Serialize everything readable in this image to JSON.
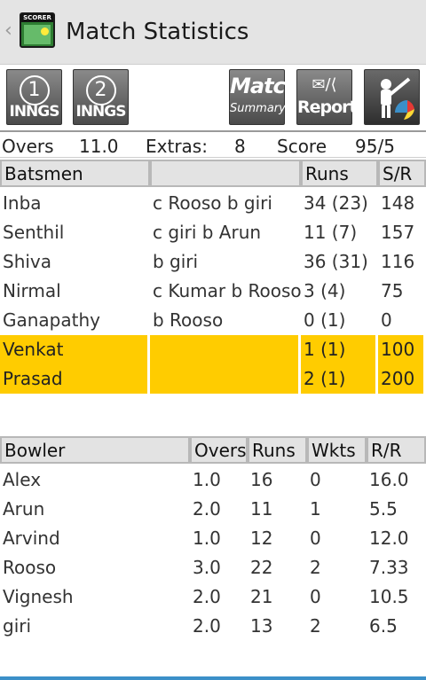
{
  "actionbar": {
    "title": "Match Statistics",
    "back_icon": "chevron-left-icon",
    "app_icon_text": "SCORER"
  },
  "toolbar": {
    "innings1": {
      "num": "1",
      "label": "INNGS"
    },
    "innings2": {
      "num": "2",
      "label": "INNGS"
    },
    "summary": {
      "big": "Match",
      "small": "Summary"
    },
    "reports": {
      "icons": "✉/⟨",
      "label": "Reports"
    }
  },
  "summary_line": {
    "overs_label": "Overs",
    "overs": "11.0",
    "extras_label": "Extras:",
    "extras": "8",
    "score_label": "Score",
    "score": "95/5"
  },
  "batting": {
    "headers": [
      "Batsmen",
      "",
      "Runs",
      "S/R"
    ],
    "rows": [
      {
        "name": "Inba",
        "dismissal": "c Rooso b giri",
        "runs": "34 (23)",
        "sr": "148",
        "highlight": false
      },
      {
        "name": "Senthil",
        "dismissal": "c giri b Arun",
        "runs": "11 (7)",
        "sr": "157",
        "highlight": false
      },
      {
        "name": "Shiva",
        "dismissal": "b giri",
        "runs": "36 (31)",
        "sr": "116",
        "highlight": false
      },
      {
        "name": "Nirmal",
        "dismissal": "c Kumar b Rooso",
        "runs": "3 (4)",
        "sr": "75",
        "highlight": false
      },
      {
        "name": "Ganapathy",
        "dismissal": "b Rooso",
        "runs": "0 (1)",
        "sr": "0",
        "highlight": false
      },
      {
        "name": "Venkat",
        "dismissal": "",
        "runs": "1 (1)",
        "sr": "100",
        "highlight": true
      },
      {
        "name": "Prasad",
        "dismissal": "",
        "runs": "2 (1)",
        "sr": "200",
        "highlight": true
      }
    ]
  },
  "bowling": {
    "headers": [
      "Bowler",
      "Overs",
      "Runs",
      "Wkts",
      "R/R"
    ],
    "rows": [
      {
        "name": "Alex",
        "overs": "1.0",
        "runs": "16",
        "wkts": "0",
        "rr": "16.0"
      },
      {
        "name": "Arun",
        "overs": "2.0",
        "runs": "11",
        "wkts": "1",
        "rr": "5.5"
      },
      {
        "name": "Arvind",
        "overs": "1.0",
        "runs": "12",
        "wkts": "0",
        "rr": "12.0"
      },
      {
        "name": "Rooso",
        "overs": "3.0",
        "runs": "22",
        "wkts": "2",
        "rr": "7.33"
      },
      {
        "name": "Vignesh",
        "overs": "2.0",
        "runs": "21",
        "wkts": "0",
        "rr": "10.5"
      },
      {
        "name": "giri",
        "overs": "2.0",
        "runs": "13",
        "wkts": "2",
        "rr": "6.5"
      }
    ]
  },
  "colors": {
    "highlight": "#ffcc00",
    "header_bg": "#e3e3e3",
    "actionbar_bg": "#e4e4e4",
    "accent_line": "#3b8fc8"
  }
}
